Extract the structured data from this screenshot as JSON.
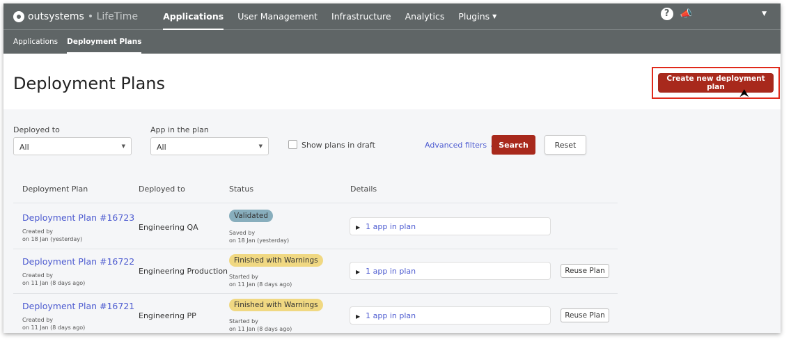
{
  "brand": {
    "name": "outsystems",
    "sep": "•",
    "product": "LifeTime"
  },
  "nav": {
    "items": [
      "Applications",
      "User Management",
      "Infrastructure",
      "Analytics",
      "Plugins"
    ],
    "active": 0
  },
  "subnav": {
    "items": [
      "Applications",
      "Deployment Plans"
    ],
    "active": 1
  },
  "icons": {
    "help": "?",
    "announce": "📣",
    "caret": "▼"
  },
  "page": {
    "title": "Deployment Plans",
    "create_label": "Create new deployment plan"
  },
  "filters": {
    "deployed_to_label": "Deployed to",
    "deployed_to_value": "All",
    "app_label": "App in the plan",
    "app_value": "All",
    "draft_label": "Show plans in draft",
    "advanced": "Advanced filters ⌄",
    "search": "Search",
    "reset": "Reset"
  },
  "table": {
    "headers": [
      "Deployment Plan",
      "Deployed to",
      "Status",
      "Details"
    ],
    "rows": [
      {
        "plan": "Deployment Plan #16723",
        "created": "Created by",
        "created_on": "on 18 Jan (yesterday)",
        "env": "Engineering QA",
        "status": "Validated",
        "by": "Saved by",
        "on": "on 18 Jan (yesterday)",
        "details": "1 app in plan",
        "reuse": ""
      },
      {
        "plan": "Deployment Plan #16722",
        "created": "Created by",
        "created_on": "on 11 Jan (8 days ago)",
        "env": "Engineering Production",
        "status": "Finished with Warnings",
        "by": "Started by",
        "on": "on 11 Jan (8 days ago)",
        "details": "1 app in plan",
        "reuse": "Reuse Plan"
      },
      {
        "plan": "Deployment Plan #16721",
        "created": "Created by",
        "created_on": "on 11 Jan (8 days ago)",
        "env": "Engineering PP",
        "status": "Finished with Warnings",
        "by": "Started by",
        "on": "on 11 Jan (8 days ago)",
        "details": "1 app in plan",
        "reuse": "Reuse Plan"
      }
    ]
  },
  "colors": {
    "topbar": "#5f6566",
    "primary": "#a8291c",
    "link": "#4d5bd0",
    "validated": "#88aebd",
    "warning": "#f0d882"
  }
}
